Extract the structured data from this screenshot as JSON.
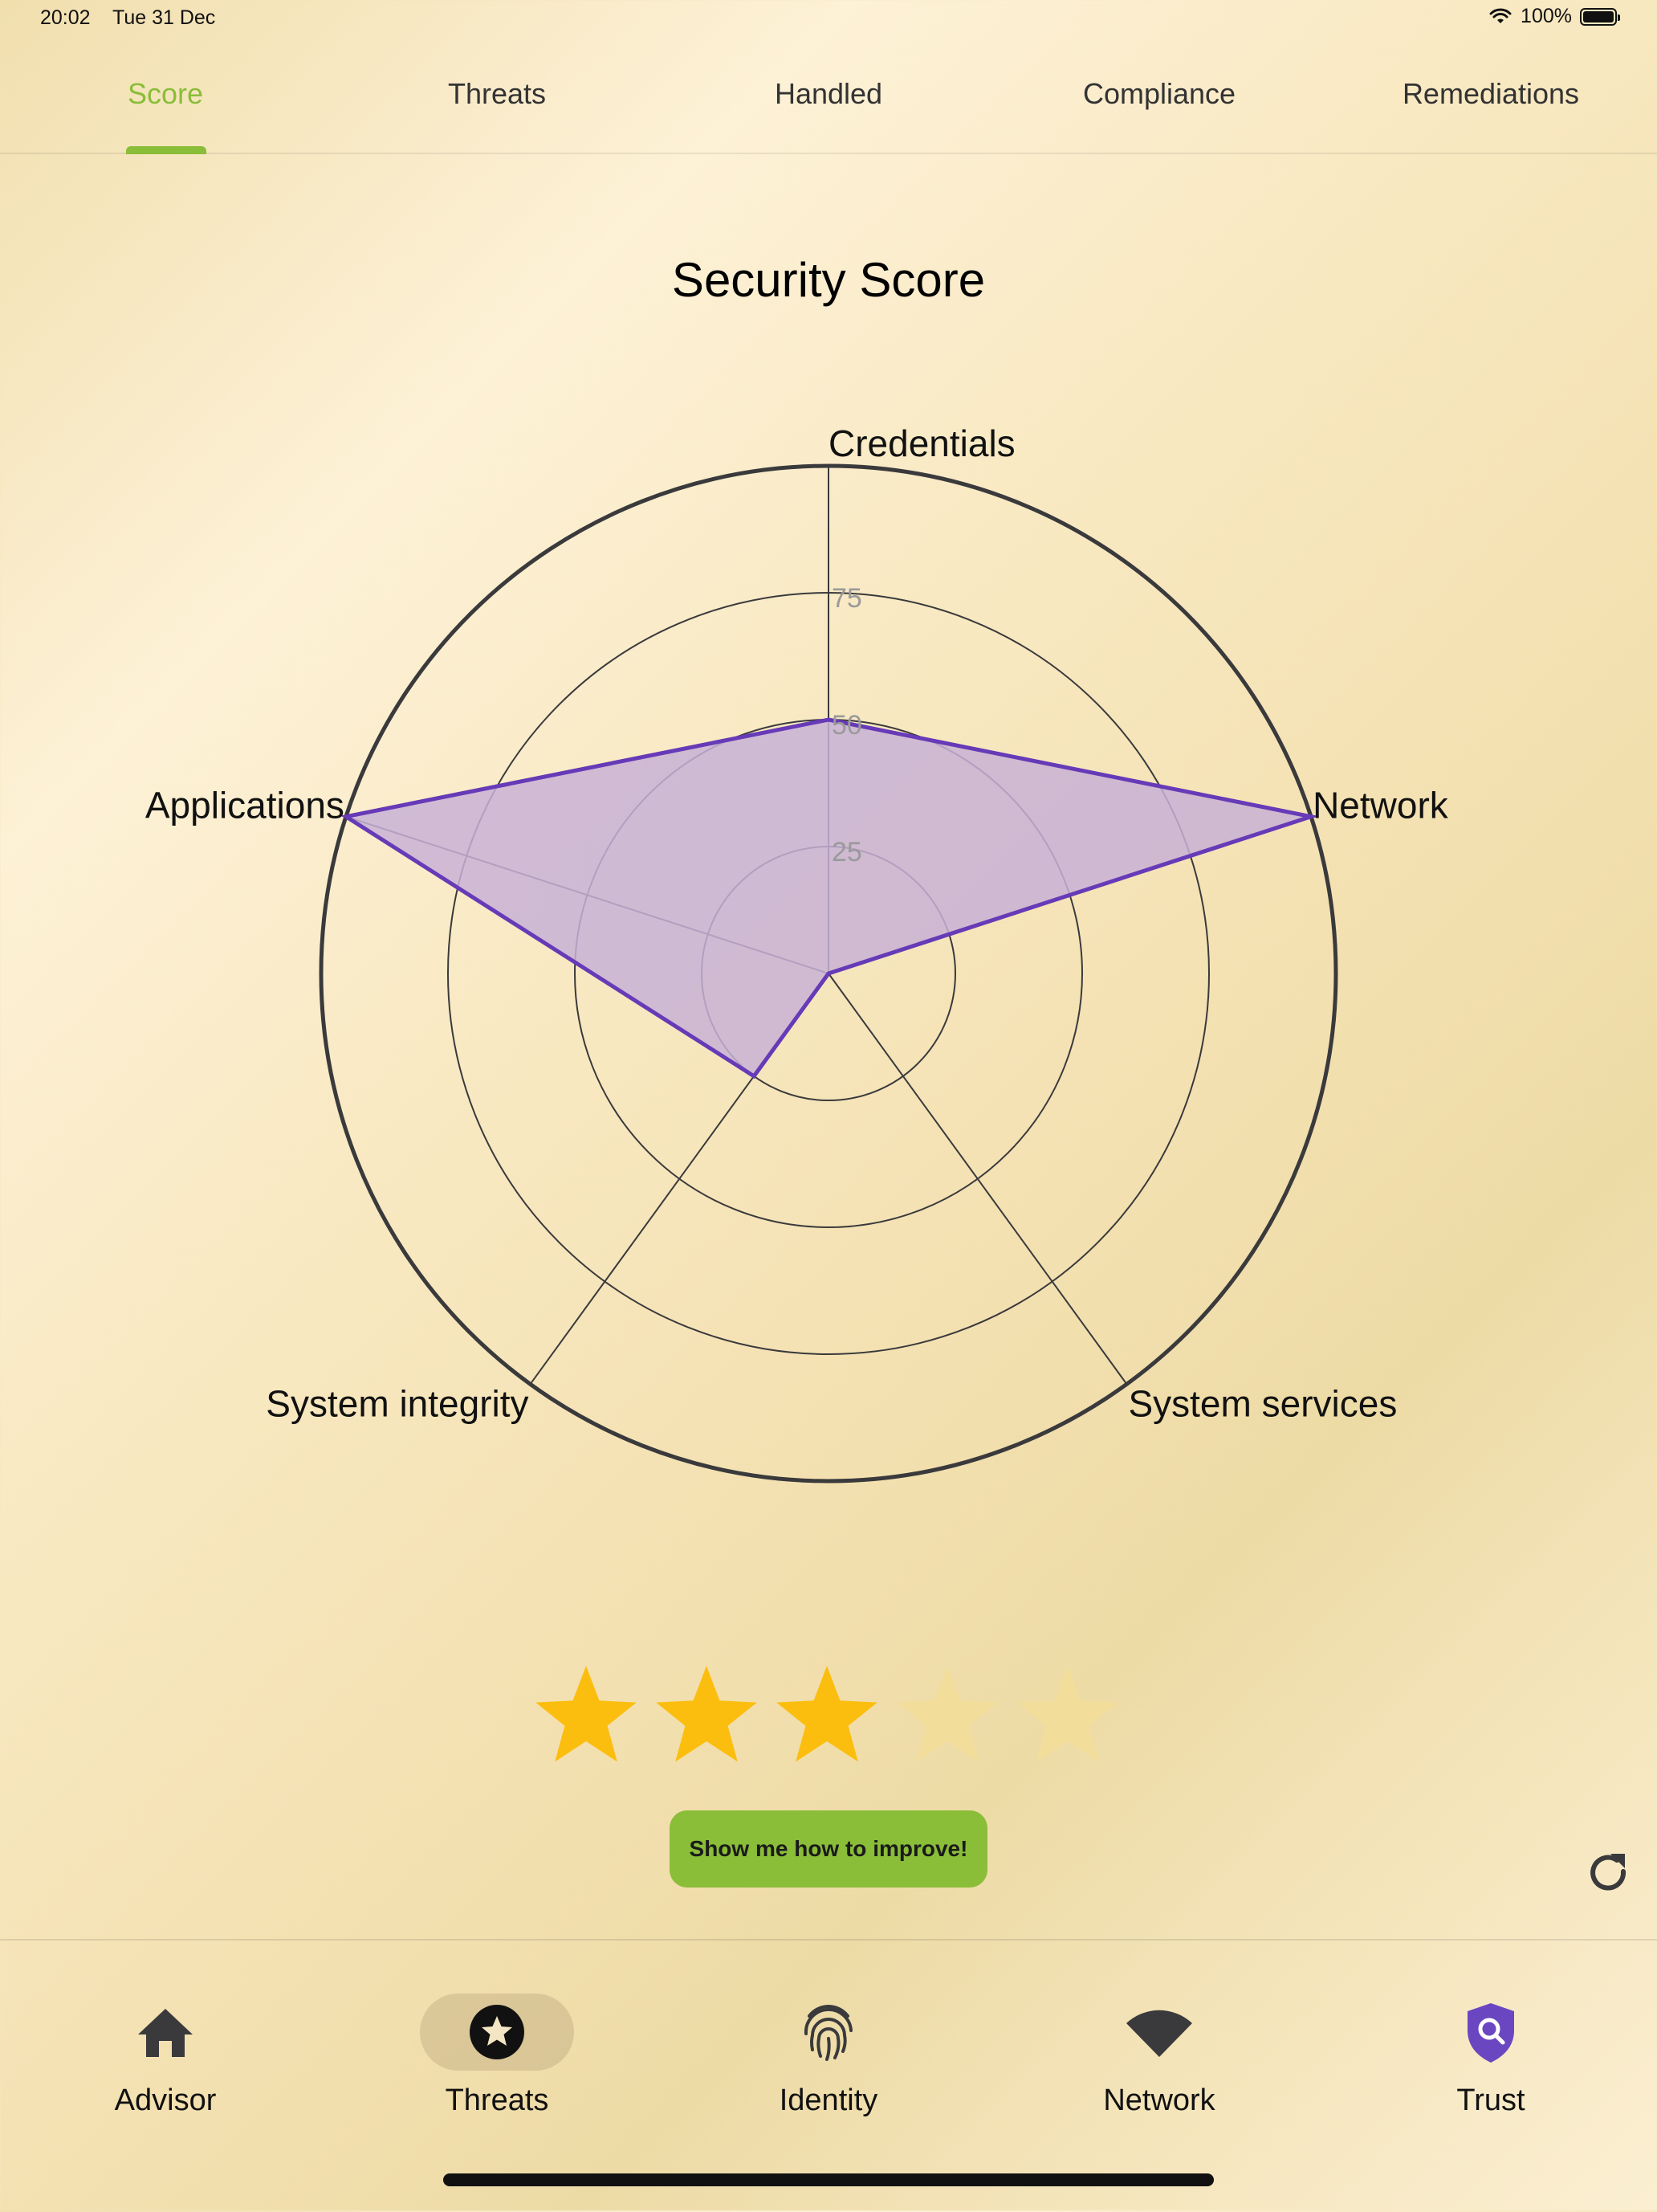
{
  "status_bar": {
    "time": "20:02",
    "date": "Tue 31 Dec",
    "battery_percent": "100%",
    "battery_level": 1.0
  },
  "top_tabs": [
    {
      "label": "Score",
      "active": true
    },
    {
      "label": "Threats",
      "active": false
    },
    {
      "label": "Handled",
      "active": false
    },
    {
      "label": "Compliance",
      "active": false
    },
    {
      "label": "Remediations",
      "active": false
    }
  ],
  "page": {
    "title": "Security Score"
  },
  "chart_data": {
    "type": "radar",
    "axes": [
      "Credentials",
      "Network",
      "System services",
      "System integrity",
      "Applications"
    ],
    "values": [
      50,
      100,
      0,
      25,
      100
    ],
    "range": [
      0,
      100
    ],
    "ring_ticks": [
      25,
      50,
      75
    ],
    "ring_values": [
      25,
      50,
      75,
      100
    ],
    "series_color": "#673ab7",
    "fill_color": "#c8b2d6"
  },
  "rating": {
    "value": 3,
    "max": 5,
    "filled_color": "#fcbe0e",
    "empty_color": "#f2dd9b"
  },
  "improve_button": {
    "label": "Show me how to improve!"
  },
  "refresh": {
    "icon": "refresh-icon"
  },
  "bottom_nav": [
    {
      "label": "Advisor",
      "icon": "home-icon",
      "active": false
    },
    {
      "label": "Threats",
      "icon": "star-badge-icon",
      "active": true
    },
    {
      "label": "Identity",
      "icon": "fingerprint-icon",
      "active": false
    },
    {
      "label": "Network",
      "icon": "wifi-icon",
      "active": false
    },
    {
      "label": "Trust",
      "icon": "shield-search-icon",
      "active": false
    }
  ],
  "colors": {
    "accent_green": "#8abd38",
    "trust_purple": "#6b46c1"
  }
}
